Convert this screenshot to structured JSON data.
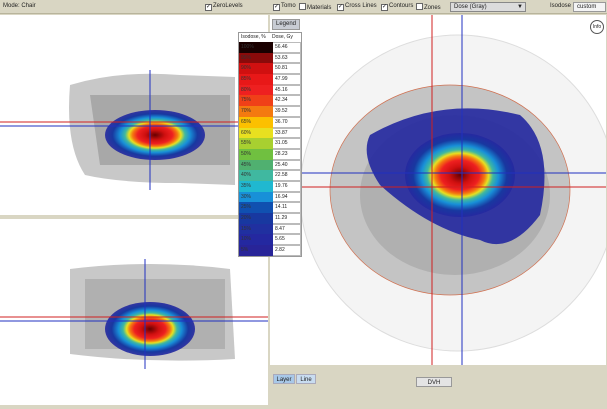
{
  "toolbar": {
    "mode": "Mode: Chair",
    "zero_levels": {
      "label": "ZeroLevels",
      "checked": true
    },
    "tomo": {
      "label": "Tomo",
      "checked": true
    },
    "materials": {
      "label": "Materials",
      "checked": false
    },
    "cross_lines": {
      "label": "Cross Lines",
      "checked": true
    },
    "contours": {
      "label": "Contours",
      "checked": true
    },
    "zones": {
      "label": "Zones",
      "checked": false
    },
    "display_select": "Dose (Gray)",
    "isodose_label": "Isodose",
    "isodose_value": "custom"
  },
  "legend": {
    "tab": "Legend",
    "col_isodose": "Isodose, %",
    "col_dose": "Dose, Gy",
    "rows": [
      {
        "pct": "100%",
        "dose": "56.46",
        "color": "#1a0000"
      },
      {
        "pct": "95%",
        "dose": "53.63",
        "color": "#8a0a0a"
      },
      {
        "pct": "90%",
        "dose": "50.81",
        "color": "#d01010"
      },
      {
        "pct": "85%",
        "dose": "47.99",
        "color": "#e81818"
      },
      {
        "pct": "80%",
        "dose": "45.16",
        "color": "#ee2020"
      },
      {
        "pct": "75%",
        "dose": "42.34",
        "color": "#f04018"
      },
      {
        "pct": "70%",
        "dose": "39.52",
        "color": "#f47a10"
      },
      {
        "pct": "65%",
        "dose": "36.70",
        "color": "#fcc000"
      },
      {
        "pct": "60%",
        "dose": "33.87",
        "color": "#e8e020"
      },
      {
        "pct": "55%",
        "dose": "31.05",
        "color": "#a8d030"
      },
      {
        "pct": "50%",
        "dose": "28.23",
        "color": "#70c040"
      },
      {
        "pct": "45%",
        "dose": "25.40",
        "color": "#50b070"
      },
      {
        "pct": "40%",
        "dose": "22.58",
        "color": "#40b8a0"
      },
      {
        "pct": "35%",
        "dose": "19.76",
        "color": "#20b8d0"
      },
      {
        "pct": "30%",
        "dose": "16.94",
        "color": "#1890d8"
      },
      {
        "pct": "25%",
        "dose": "14.11",
        "color": "#1050b0"
      },
      {
        "pct": "20%",
        "dose": "11.29",
        "color": "#1838a0"
      },
      {
        "pct": "15%",
        "dose": "8.47",
        "color": "#2030a0"
      },
      {
        "pct": "10%",
        "dose": "5.65",
        "color": "#2428a0"
      },
      {
        "pct": "5%",
        "dose": "2.82",
        "color": "#282498"
      }
    ]
  },
  "info_button": "Info",
  "bottom": {
    "layer": "Layer",
    "line": "Line",
    "dvh": "DVH"
  }
}
